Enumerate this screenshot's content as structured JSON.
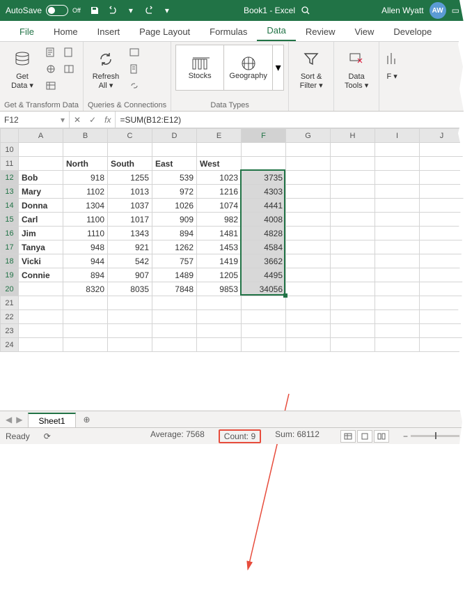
{
  "titlebar": {
    "autosave_label": "AutoSave",
    "autosave_state": "Off",
    "doc_title": "Book1 - Excel",
    "user_name": "Allen Wyatt",
    "user_initials": "AW"
  },
  "tabs": [
    "File",
    "Home",
    "Insert",
    "Page Layout",
    "Formulas",
    "Data",
    "Review",
    "View",
    "Develope"
  ],
  "active_tab": "Data",
  "ribbon": {
    "group1": {
      "label": "Get & Transform Data",
      "big": "Get\nData"
    },
    "group2": {
      "label": "Queries & Connections",
      "big": "Refresh\nAll"
    },
    "group3": {
      "label": "Data Types",
      "items": [
        "Stocks",
        "Geography"
      ]
    },
    "group4": {
      "big": "Sort &\nFilter"
    },
    "group5": {
      "big": "Data\nTools"
    },
    "group6": {
      "big": "F"
    }
  },
  "namebox": "F12",
  "formula": "=SUM(B12:E12)",
  "columns": [
    "A",
    "B",
    "C",
    "D",
    "E",
    "F",
    "G",
    "H",
    "I",
    "J"
  ],
  "first_row": 10,
  "row_count": 15,
  "headers_row": 11,
  "headers": {
    "B": "North",
    "C": "South",
    "D": "East",
    "E": "West"
  },
  "data_rows": [
    {
      "r": 12,
      "A": "Bob",
      "B": 918,
      "C": 1255,
      "D": 539,
      "E": 1023,
      "F": 3735
    },
    {
      "r": 13,
      "A": "Mary",
      "B": 1102,
      "C": 1013,
      "D": 972,
      "E": 1216,
      "F": 4303
    },
    {
      "r": 14,
      "A": "Donna",
      "B": 1304,
      "C": 1037,
      "D": 1026,
      "E": 1074,
      "F": 4441
    },
    {
      "r": 15,
      "A": "Carl",
      "B": 1100,
      "C": 1017,
      "D": 909,
      "E": 982,
      "F": 4008
    },
    {
      "r": 16,
      "A": "Jim",
      "B": 1110,
      "C": 1343,
      "D": 894,
      "E": 1481,
      "F": 4828
    },
    {
      "r": 17,
      "A": "Tanya",
      "B": 948,
      "C": 921,
      "D": 1262,
      "E": 1453,
      "F": 4584
    },
    {
      "r": 18,
      "A": "Vicki",
      "B": 944,
      "C": 542,
      "D": 757,
      "E": 1419,
      "F": 3662
    },
    {
      "r": 19,
      "A": "Connie",
      "B": 894,
      "C": 907,
      "D": 1489,
      "E": 1205,
      "F": 4495
    },
    {
      "r": 20,
      "A": "",
      "B": 8320,
      "C": 8035,
      "D": 7848,
      "E": 9853,
      "F": 34056
    }
  ],
  "selection": {
    "col": "F",
    "rows": [
      12,
      20
    ]
  },
  "sheets": {
    "nav": [
      "◀",
      "▶"
    ],
    "active": "Sheet1"
  },
  "status": {
    "ready": "Ready",
    "loading": "⟳",
    "average": "Average: 7568",
    "count": "Count: 9",
    "sum": "Sum: 68112"
  }
}
